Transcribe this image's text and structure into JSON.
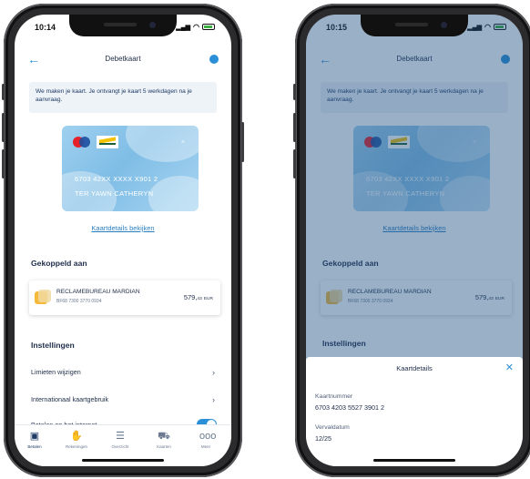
{
  "left_screen": {
    "status_time": "10:14",
    "page_title": "Debetkaart",
    "banner_text": "We maken je kaart. Je ontvangt je kaart 5 werkdagen na je aanvraag.",
    "card": {
      "number": "6703 42XX XXXX X901 2",
      "holder": "TER YAWN CATHERYN"
    },
    "details_link": "Kaartdetails bekijken",
    "linked_heading": "Gekoppeld aan",
    "account": {
      "name": "RECLAMEBUREAU MARDIAN",
      "iban": "BF68 7300 3770 0934",
      "balance_main": "579,",
      "balance_cents": "43",
      "currency": "EUR"
    },
    "settings_heading": "Instellingen",
    "settings": [
      {
        "label": "Limieten wijzigen"
      },
      {
        "label": "Internationaal kaartgebruik"
      },
      {
        "label": "Betalen op het internet",
        "toggle": true
      }
    ],
    "tabs": [
      {
        "label": "Betalen",
        "icon": "wallet-icon"
      },
      {
        "label": "Rekeningen",
        "icon": "hand-icon"
      },
      {
        "label": "Overzicht",
        "icon": "document-icon"
      },
      {
        "label": "Kaarten",
        "icon": "cart-icon"
      },
      {
        "label": "Meer",
        "icon": "more-icon"
      }
    ]
  },
  "right_screen": {
    "status_time": "10:15",
    "page_title": "Debetkaart",
    "banner_text": "We maken je kaart. Je ontvangt je kaart 5 werkdagen na je aanvraag.",
    "card": {
      "number": "6703 42XX XXXX X901 2",
      "holder": "TER YAWN CATHERYN"
    },
    "details_link": "Kaartdetails bekijken",
    "linked_heading": "Gekoppeld aan",
    "account": {
      "name": "RECLAMEBUREAU MARDIAN",
      "iban": "BF68 7300 3770 0934",
      "balance_main": "579,",
      "balance_cents": "43",
      "currency": "EUR"
    },
    "settings_heading": "Instellingen",
    "sheet": {
      "title": "Kaartdetails",
      "number_label": "Kaartnummer",
      "number_value": "6703 4203 5527 3901 2",
      "expiry_label": "Vervaldatum",
      "expiry_value": "12/25"
    }
  },
  "colors": {
    "accent": "#2a8fd6",
    "text": "#1e2d4a",
    "overlay": "#1e5082"
  }
}
